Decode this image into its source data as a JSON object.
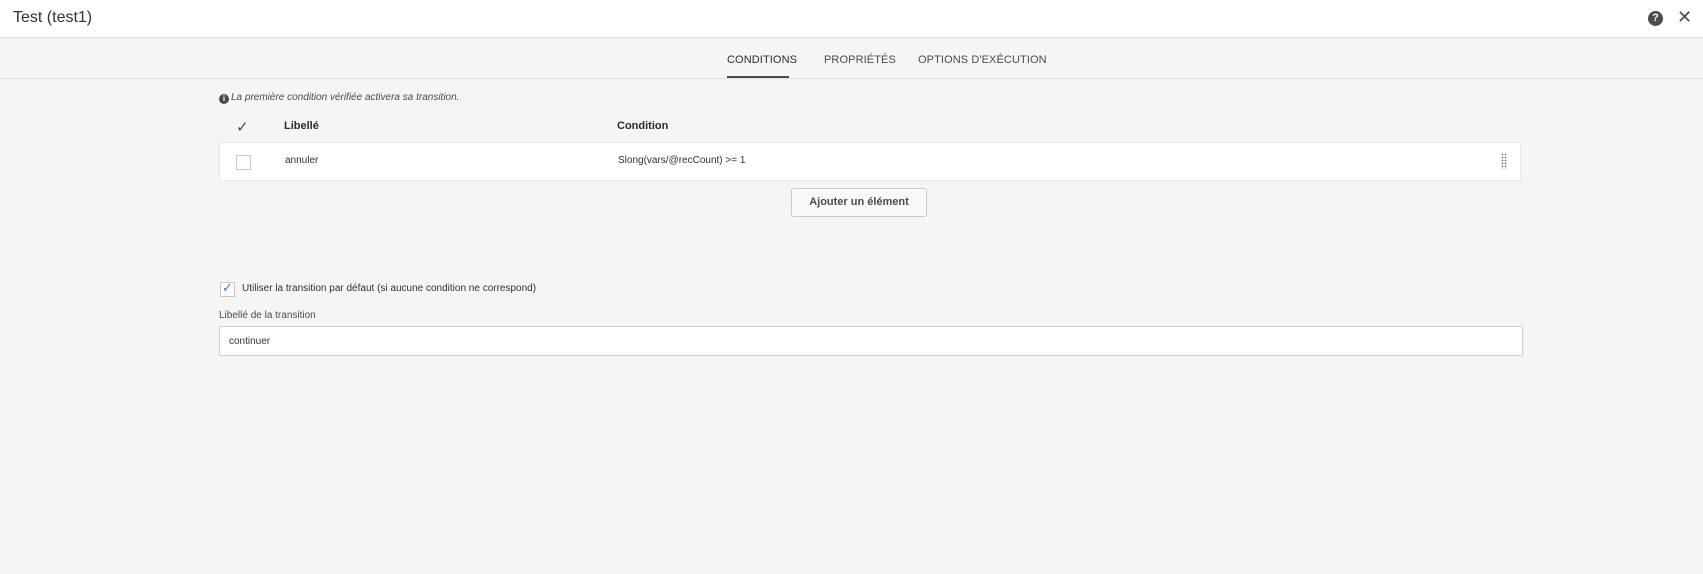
{
  "window": {
    "title": "Test (test1)"
  },
  "tabs": [
    {
      "label": "CONDITIONS",
      "active": true
    },
    {
      "label": "PROPRIÉTÉS",
      "active": false
    },
    {
      "label": "OPTIONS D'EXÉCUTION",
      "active": false
    }
  ],
  "conditions": {
    "info": "La première condition vérifiée activera sa transition.",
    "columns": {
      "label": "Libellé",
      "condition": "Condition"
    },
    "rows": [
      {
        "label": "annuler",
        "condition": "Slong(vars/@recCount) >= 1",
        "checked": false
      }
    ],
    "add_button": "Ajouter un élément"
  },
  "default_transition": {
    "checkbox_label": "Utiliser la transition par défaut (si aucune condition ne correspond)",
    "checked": true,
    "field_label": "Libellé de la transition",
    "value": "continuer"
  },
  "icons": {
    "help": "help-icon",
    "close": "close-icon",
    "info": "info-icon",
    "check": "checkmark-icon",
    "drag": "drag-handle-icon"
  },
  "colors": {
    "accent": "#2680eb",
    "background": "#f5f5f5"
  }
}
